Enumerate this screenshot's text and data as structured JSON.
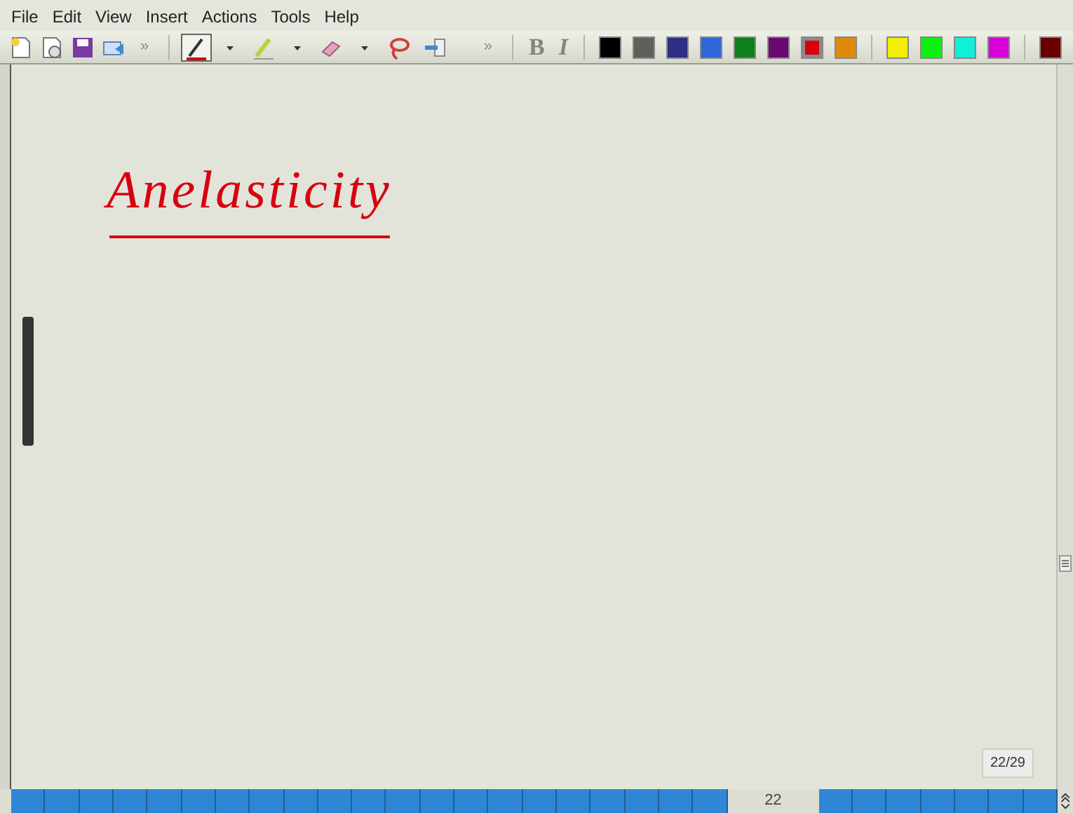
{
  "menu": [
    "File",
    "Edit",
    "View",
    "Insert",
    "Actions",
    "Tools",
    "Help"
  ],
  "toolbar": {
    "overflow_marks": [
      "»",
      "»"
    ],
    "tools": [
      {
        "kind": "pen",
        "selected": true
      },
      {
        "kind": "highlighter",
        "selected": false
      },
      {
        "kind": "eraser",
        "selected": false
      },
      {
        "kind": "lasso",
        "selected": false
      },
      {
        "kind": "insert-space",
        "selected": false
      }
    ],
    "format": [
      {
        "label": "B",
        "disabled": true
      },
      {
        "label": "I",
        "disabled": true
      }
    ],
    "colors": [
      {
        "color": "#000000",
        "selected": false
      },
      {
        "color": "#5f5f5b",
        "selected": false
      },
      {
        "color": "#2c2f85",
        "selected": false
      },
      {
        "color": "#2f66d8",
        "selected": false
      },
      {
        "color": "#0f7f1c",
        "selected": false
      },
      {
        "color": "#6a0a6e",
        "selected": false
      },
      {
        "color": "#d8000f",
        "selected": true
      },
      {
        "color": "#e08a0c",
        "selected": false
      },
      {
        "color": "#f0f000",
        "selected": false
      },
      {
        "color": "#10f010",
        "selected": false
      },
      {
        "color": "#10f0d8",
        "selected": false
      },
      {
        "color": "#d800d8",
        "selected": false
      },
      {
        "color": "#6a0000",
        "selected": false
      }
    ]
  },
  "note": {
    "heading": "Anelasticity"
  },
  "page_counter": "22/29",
  "pages": [
    {
      "selected": false
    },
    {
      "selected": false
    },
    {
      "selected": false
    },
    {
      "selected": false
    },
    {
      "selected": false
    },
    {
      "selected": false
    },
    {
      "selected": false
    },
    {
      "selected": false
    },
    {
      "selected": false
    },
    {
      "selected": false
    },
    {
      "selected": false
    },
    {
      "selected": false
    },
    {
      "selected": false
    },
    {
      "selected": false
    },
    {
      "selected": false
    },
    {
      "selected": false
    },
    {
      "selected": false
    },
    {
      "selected": false
    },
    {
      "selected": false
    },
    {
      "selected": false
    },
    {
      "selected": false
    },
    {
      "selected": true,
      "label": "22"
    },
    {
      "selected": false
    },
    {
      "selected": false
    },
    {
      "selected": false
    },
    {
      "selected": false
    },
    {
      "selected": false
    },
    {
      "selected": false
    },
    {
      "selected": false
    }
  ]
}
